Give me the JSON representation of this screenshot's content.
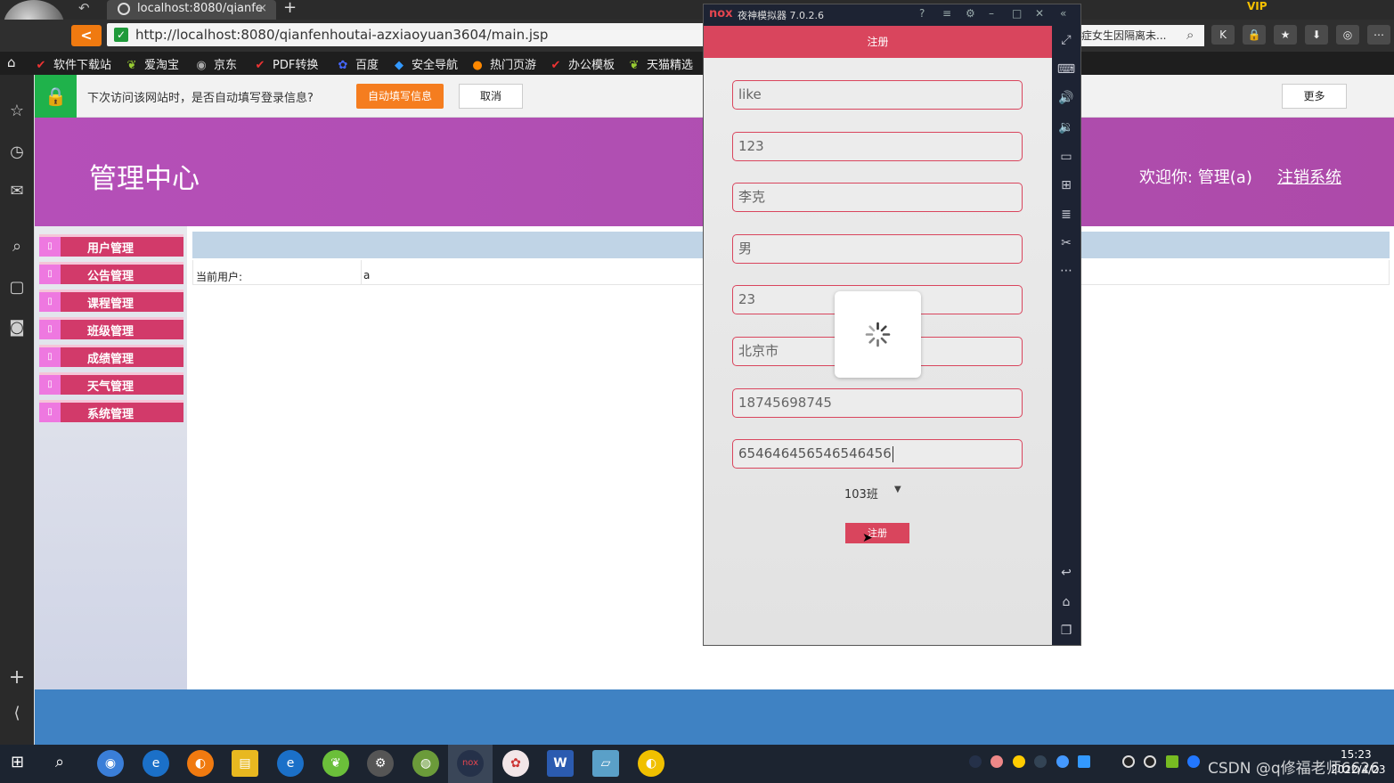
{
  "browser": {
    "tab_title": "localhost:8080/qianfe",
    "tab_close": "×",
    "new_tab": "+",
    "url": "http://localhost:8080/qianfenhoutai-azxiaoyuan3604/main.jsp",
    "search_value": "症女生因隔离未...",
    "bookmarks": [
      "软件下载站",
      "爱淘宝",
      "京东",
      "PDF转换",
      "百度",
      "安全导航",
      "热门页游",
      "办公模板",
      "天猫精选"
    ],
    "vip_label": "VIP"
  },
  "password_bar": {
    "message": "下次访问该网站时，是否自动填写登录信息?",
    "fill_label": "自动填写信息",
    "cancel_label": "取消",
    "more_label": "更多"
  },
  "site": {
    "title": "管理中心",
    "welcome": "欢迎你:  管理(a)",
    "logout": "注销系统",
    "nav": [
      "用户管理",
      "公告管理",
      "课程管理",
      "班级管理",
      "成绩管理",
      "天气管理",
      "系统管理"
    ],
    "current_user_label": "当前用户:",
    "current_user_value": "a"
  },
  "emulator": {
    "title": "夜神模拟器 7.0.2.6",
    "logo": "nox",
    "app_header": "注册",
    "fields": [
      "like",
      "123",
      "李克",
      "男",
      "23",
      "北京市",
      "18745698745",
      "654646456546546456"
    ],
    "class_selected": "103班",
    "register_button": "注册"
  },
  "taskbar": {
    "time": "15:23",
    "date": "2022/4/23",
    "watermark": "CSDN @q修福老师6626"
  },
  "colors": {
    "header": "#b04fb2",
    "nav_item": "#d23a6a",
    "app_accent": "#d9455d",
    "footer": "#3f82c3"
  }
}
